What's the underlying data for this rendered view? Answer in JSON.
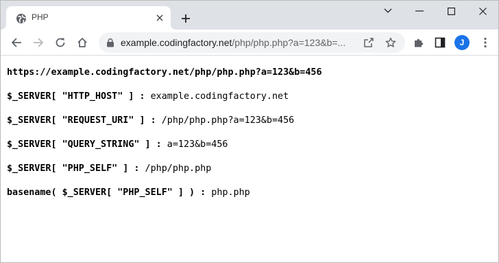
{
  "browser": {
    "tab": {
      "title": "PHP",
      "favicon": "globe-icon"
    },
    "address_bar": {
      "host": "example.codingfactory.net",
      "path": "/php/php.php?a=123&b=..."
    },
    "profile_initial": "J",
    "accent_color": "#1a73e8"
  },
  "page": {
    "lines": [
      {
        "label": "https://example.codingfactory.net/php/php.php?a=123&b=456",
        "value": ""
      },
      {
        "label": "$_SERVER[ \"HTTP_HOST\" ] :",
        "value": "example.codingfactory.net"
      },
      {
        "label": "$_SERVER[ \"REQUEST_URI\" ] :",
        "value": "/php/php.php?a=123&b=456"
      },
      {
        "label": "$_SERVER[ \"QUERY_STRING\" ] :",
        "value": "a=123&b=456"
      },
      {
        "label": "$_SERVER[ \"PHP_SELF\" ] :",
        "value": "/php/php.php"
      },
      {
        "label": "basename( $_SERVER[ \"PHP_SELF\" ] ) :",
        "value": "php.php"
      }
    ]
  }
}
